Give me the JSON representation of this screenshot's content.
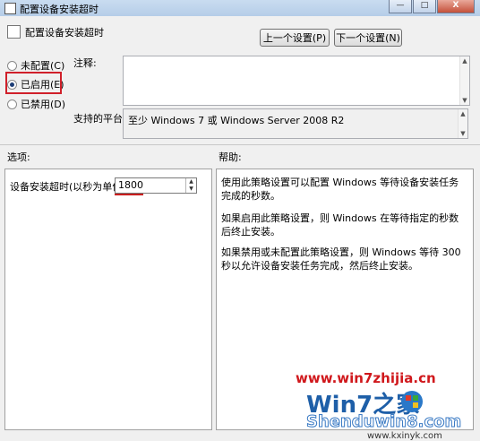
{
  "window": {
    "title": "配置设备安装超时",
    "controls": [
      "—",
      "□",
      "X"
    ]
  },
  "header": {
    "title": "配置设备安装超时",
    "prev_button": "上一个设置(P)",
    "next_button": "下一个设置(N)"
  },
  "state": {
    "options": [
      {
        "label": "未配置(C)",
        "checked": false
      },
      {
        "label": "已启用(E)",
        "checked": true
      },
      {
        "label": "已禁用(D)",
        "checked": false
      }
    ]
  },
  "comment": {
    "label": "注释:",
    "value": ""
  },
  "platform": {
    "label": "支持的平台:",
    "value": "至少 Windows 7 或 Windows Server 2008 R2"
  },
  "options_section": {
    "label": "选项:",
    "timeout_label": "设备安装超时(以秒为单位)",
    "timeout_value": "1800"
  },
  "help_section": {
    "label": "帮助:",
    "paragraphs": [
      "使用此策略设置可以配置 Windows 等待设备安装任务完成的秒数。",
      "如果启用此策略设置，则 Windows 在等待指定的秒数后终止安装。",
      "如果禁用或未配置此策略设置，则 Windows 等待 300 秒以允许设备安装任务完成，然后终止安装。"
    ]
  },
  "watermark": {
    "url": "www.win7zhijia.cn",
    "logo_text": "Win7之家",
    "site_name": "Shenduwin8.com",
    "site_url": "www.kxinyk.com",
    "colors": {
      "url": "#d0181c",
      "logo_blue": "#1e5fa8"
    }
  }
}
